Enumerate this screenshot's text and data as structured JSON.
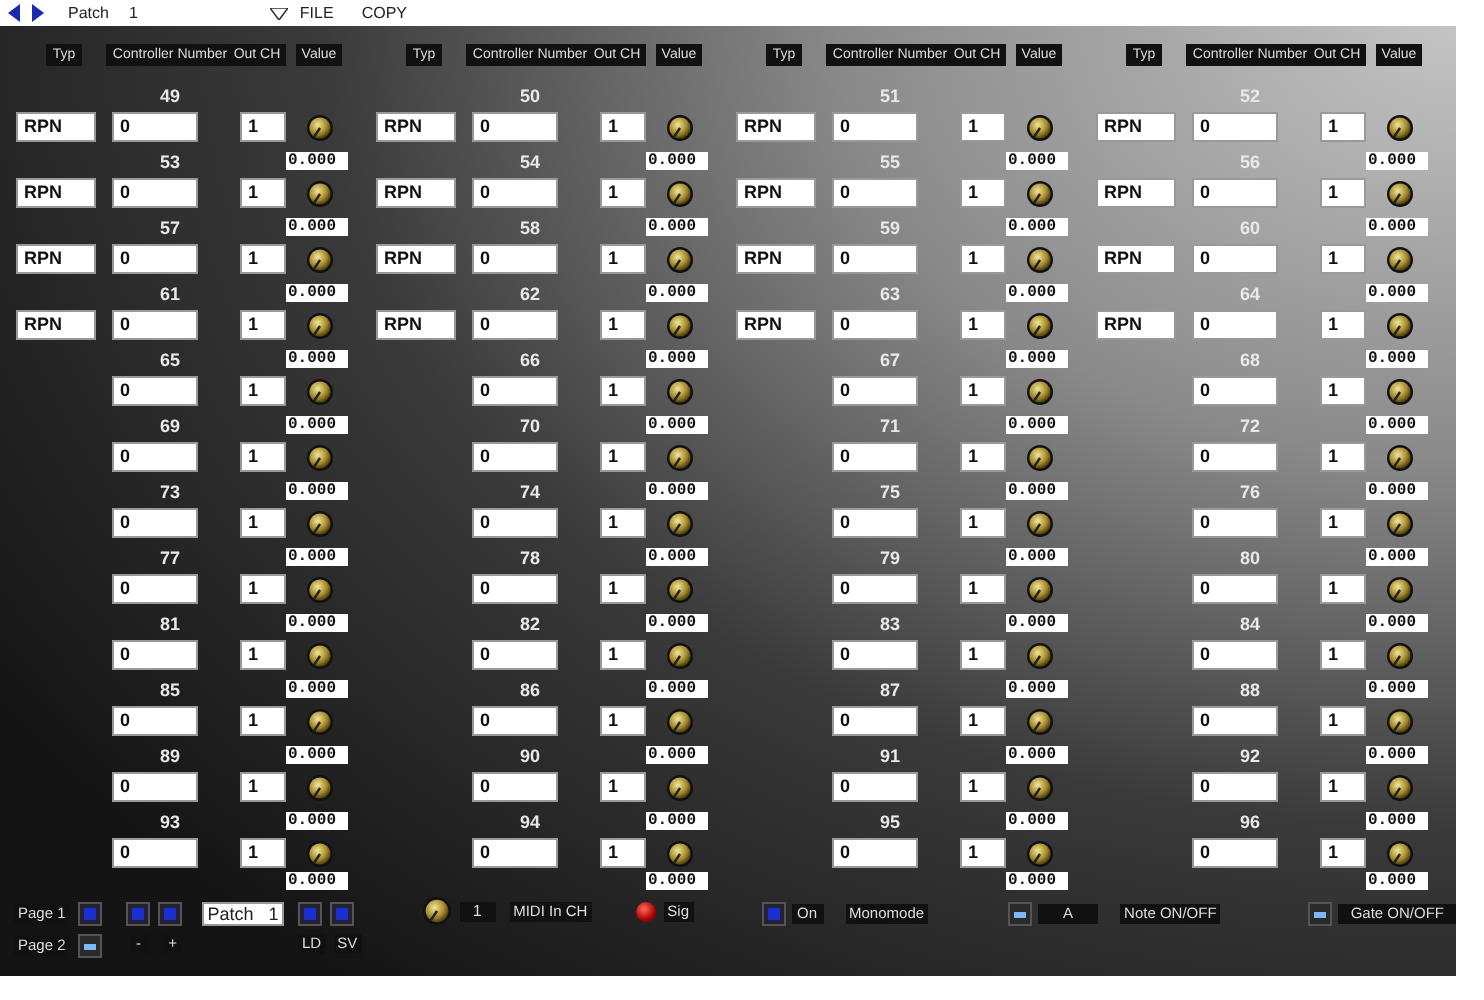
{
  "topbar": {
    "patch_label": "Patch",
    "patch_number": "1",
    "menus": [
      "FILE",
      "COPY"
    ]
  },
  "columns": [
    {
      "headers": [
        "Typ",
        "Controller Number",
        "Out CH",
        "Value"
      ],
      "rows": [
        {
          "number": "49",
          "typ": "RPN",
          "controller": "0",
          "out_ch": "1",
          "value": "0.000"
        },
        {
          "number": "53",
          "typ": "RPN",
          "controller": "0",
          "out_ch": "1",
          "value": "0.000"
        },
        {
          "number": "57",
          "typ": "RPN",
          "controller": "0",
          "out_ch": "1",
          "value": "0.000"
        },
        {
          "number": "61",
          "typ": "RPN",
          "controller": "0",
          "out_ch": "1",
          "value": "0.000"
        },
        {
          "number": "65",
          "controller": "0",
          "out_ch": "1",
          "value": "0.000"
        },
        {
          "number": "69",
          "controller": "0",
          "out_ch": "1",
          "value": "0.000"
        },
        {
          "number": "73",
          "controller": "0",
          "out_ch": "1",
          "value": "0.000"
        },
        {
          "number": "77",
          "controller": "0",
          "out_ch": "1",
          "value": "0.000"
        },
        {
          "number": "81",
          "controller": "0",
          "out_ch": "1",
          "value": "0.000"
        },
        {
          "number": "85",
          "controller": "0",
          "out_ch": "1",
          "value": "0.000"
        },
        {
          "number": "89",
          "controller": "0",
          "out_ch": "1",
          "value": "0.000"
        },
        {
          "number": "93",
          "controller": "0",
          "out_ch": "1",
          "value": "0.000"
        }
      ]
    },
    {
      "headers": [
        "Typ",
        "Controller Number",
        "Out CH",
        "Value"
      ],
      "rows": [
        {
          "number": "50",
          "typ": "RPN",
          "controller": "0",
          "out_ch": "1",
          "value": "0.000"
        },
        {
          "number": "54",
          "typ": "RPN",
          "controller": "0",
          "out_ch": "1",
          "value": "0.000"
        },
        {
          "number": "58",
          "typ": "RPN",
          "controller": "0",
          "out_ch": "1",
          "value": "0.000"
        },
        {
          "number": "62",
          "typ": "RPN",
          "controller": "0",
          "out_ch": "1",
          "value": "0.000"
        },
        {
          "number": "66",
          "controller": "0",
          "out_ch": "1",
          "value": "0.000"
        },
        {
          "number": "70",
          "controller": "0",
          "out_ch": "1",
          "value": "0.000"
        },
        {
          "number": "74",
          "controller": "0",
          "out_ch": "1",
          "value": "0.000"
        },
        {
          "number": "78",
          "controller": "0",
          "out_ch": "1",
          "value": "0.000"
        },
        {
          "number": "82",
          "controller": "0",
          "out_ch": "1",
          "value": "0.000"
        },
        {
          "number": "86",
          "controller": "0",
          "out_ch": "1",
          "value": "0.000"
        },
        {
          "number": "90",
          "controller": "0",
          "out_ch": "1",
          "value": "0.000"
        },
        {
          "number": "94",
          "controller": "0",
          "out_ch": "1",
          "value": "0.000"
        }
      ]
    },
    {
      "headers": [
        "Typ",
        "Controller Number",
        "Out CH",
        "Value"
      ],
      "rows": [
        {
          "number": "51",
          "typ": "RPN",
          "controller": "0",
          "out_ch": "1",
          "value": "0.000"
        },
        {
          "number": "55",
          "typ": "RPN",
          "controller": "0",
          "out_ch": "1",
          "value": "0.000"
        },
        {
          "number": "59",
          "typ": "RPN",
          "controller": "0",
          "out_ch": "1",
          "value": "0.000"
        },
        {
          "number": "63",
          "typ": "RPN",
          "controller": "0",
          "out_ch": "1",
          "value": "0.000"
        },
        {
          "number": "67",
          "controller": "0",
          "out_ch": "1",
          "value": "0.000"
        },
        {
          "number": "71",
          "controller": "0",
          "out_ch": "1",
          "value": "0.000"
        },
        {
          "number": "75",
          "controller": "0",
          "out_ch": "1",
          "value": "0.000"
        },
        {
          "number": "79",
          "controller": "0",
          "out_ch": "1",
          "value": "0.000"
        },
        {
          "number": "83",
          "controller": "0",
          "out_ch": "1",
          "value": "0.000"
        },
        {
          "number": "87",
          "controller": "0",
          "out_ch": "1",
          "value": "0.000"
        },
        {
          "number": "91",
          "controller": "0",
          "out_ch": "1",
          "value": "0.000"
        },
        {
          "number": "95",
          "controller": "0",
          "out_ch": "1",
          "value": "0.000"
        }
      ]
    },
    {
      "headers": [
        "Typ",
        "Controller Number",
        "Out CH",
        "Value"
      ],
      "rows": [
        {
          "number": "52",
          "typ": "RPN",
          "controller": "0",
          "out_ch": "1",
          "value": "0.000"
        },
        {
          "number": "56",
          "typ": "RPN",
          "controller": "0",
          "out_ch": "1",
          "value": "0.000"
        },
        {
          "number": "60",
          "typ": "RPN",
          "controller": "0",
          "out_ch": "1",
          "value": "0.000"
        },
        {
          "number": "64",
          "typ": "RPN",
          "controller": "0",
          "out_ch": "1",
          "value": "0.000"
        },
        {
          "number": "68",
          "controller": "0",
          "out_ch": "1",
          "value": "0.000"
        },
        {
          "number": "72",
          "controller": "0",
          "out_ch": "1",
          "value": "0.000"
        },
        {
          "number": "76",
          "controller": "0",
          "out_ch": "1",
          "value": "0.000"
        },
        {
          "number": "80",
          "controller": "0",
          "out_ch": "1",
          "value": "0.000"
        },
        {
          "number": "84",
          "controller": "0",
          "out_ch": "1",
          "value": "0.000"
        },
        {
          "number": "88",
          "controller": "0",
          "out_ch": "1",
          "value": "0.000"
        },
        {
          "number": "92",
          "controller": "0",
          "out_ch": "1",
          "value": "0.000"
        },
        {
          "number": "96",
          "controller": "0",
          "out_ch": "1",
          "value": "0.000"
        }
      ]
    }
  ],
  "footer": {
    "pages": [
      {
        "label": "Page 1",
        "selected": false
      },
      {
        "label": "Page 2",
        "selected": true
      }
    ],
    "step_buttons": [
      "-",
      "+"
    ],
    "patch_field": "Patch   1",
    "store_buttons": [
      "LD",
      "SV"
    ],
    "midi_in": {
      "value": "1",
      "label": "MIDI In CH"
    },
    "signal": {
      "label": "Sig",
      "on": true
    },
    "toggles": [
      {
        "state_label": "On",
        "label": "Monomode",
        "on": true
      },
      {
        "state_label": "A",
        "label": "Note ON/OFF",
        "on": false
      },
      {
        "label": "Gate ON/OFF",
        "on": false
      }
    ]
  }
}
